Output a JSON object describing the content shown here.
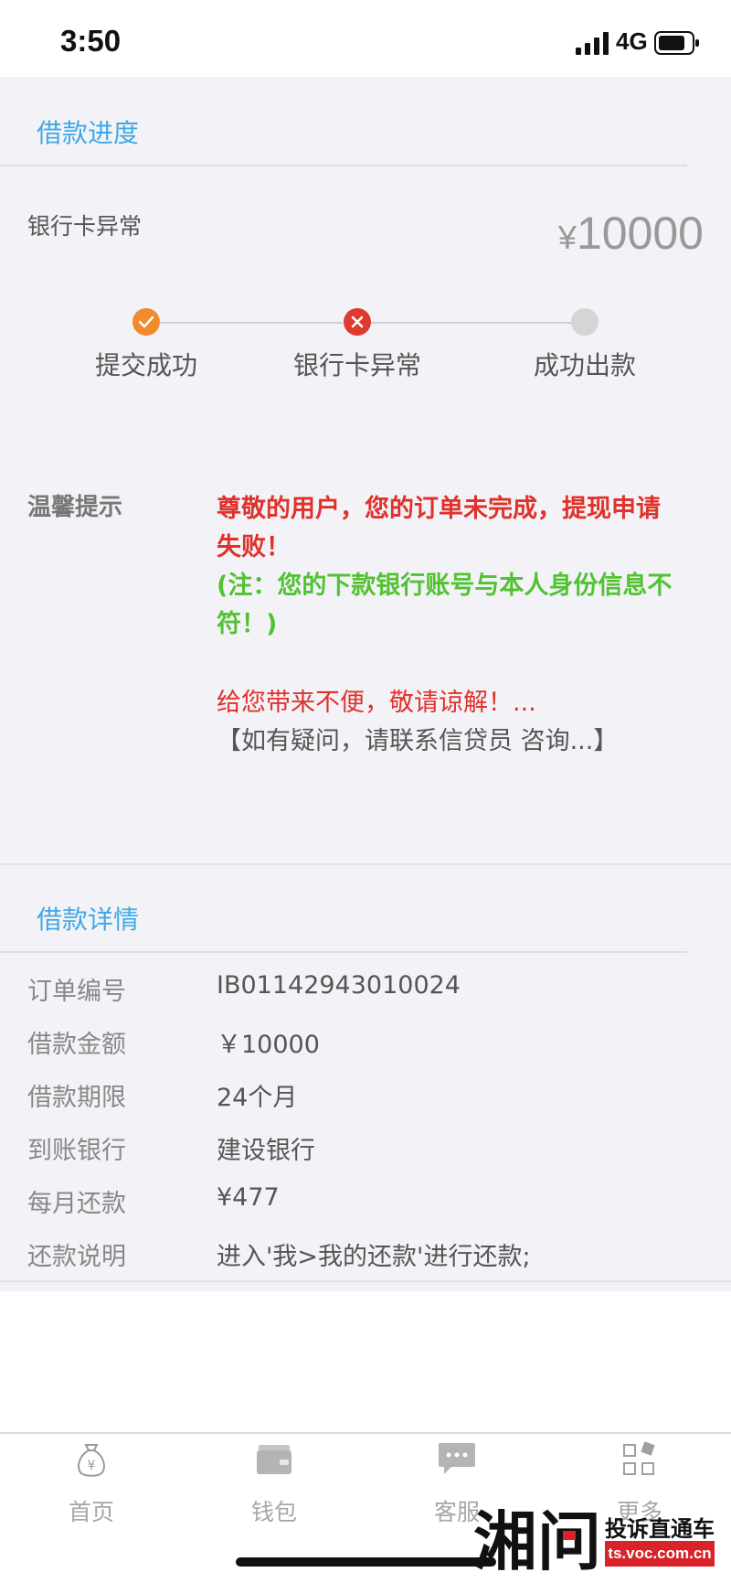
{
  "status_bar": {
    "time": "3:50",
    "network": "4G"
  },
  "progress_section": {
    "title": "借款进度",
    "status_text": "银行卡异常",
    "amount_symbol": "¥",
    "amount": "10000",
    "steps": [
      {
        "label": "提交成功",
        "state": "done",
        "color": "#f08a2c"
      },
      {
        "label": "银行卡异常",
        "state": "error",
        "color": "#e03a2f"
      },
      {
        "label": "成功出款",
        "state": "pending",
        "color": "#d5d5d5"
      }
    ]
  },
  "tip": {
    "label": "温馨提示",
    "line1": "尊敬的用户，您的订单未完成，提现申请",
    "line2": "失败！",
    "note_line1": "(注：您的下款银行账号与本人身份信息不",
    "note_line2": "符！)",
    "line3": "给您带来不便，敬请谅解！...",
    "line4": "【如有疑问，请联系信贷员 咨询...】"
  },
  "details_section": {
    "title": "借款详情",
    "rows": [
      {
        "label": "订单编号",
        "value": "IB01142943010024"
      },
      {
        "label": "借款金额",
        "value": "￥10000"
      },
      {
        "label": "借款期限",
        "value": "24个月"
      },
      {
        "label": "到账银行",
        "value": "建设银行"
      },
      {
        "label": "每月还款",
        "value": "¥477"
      },
      {
        "label": "还款说明",
        "value": "进入'我>我的还款'进行还款;"
      }
    ]
  },
  "tabbar": {
    "tabs": [
      {
        "label": "首页",
        "icon": "money-bag-icon"
      },
      {
        "label": "钱包",
        "icon": "wallet-icon"
      },
      {
        "label": "客服",
        "icon": "chat-icon"
      },
      {
        "label": "更多",
        "icon": "grid-icon"
      }
    ]
  },
  "watermark": {
    "logo_text": "湘问",
    "name": "投诉直通车",
    "domain": "ts.voc.com.cn"
  },
  "colors": {
    "accent_blue": "#3fa9e6",
    "alert_red": "#e0312b",
    "note_green": "#52c232"
  }
}
